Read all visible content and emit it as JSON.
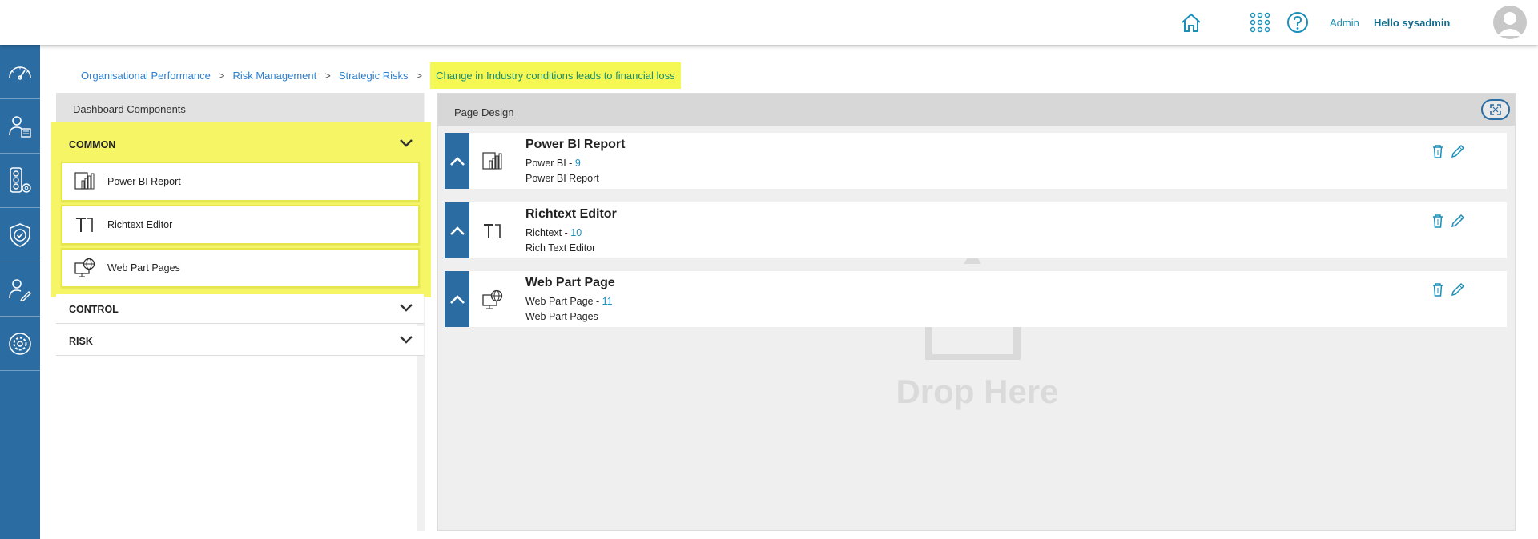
{
  "header": {
    "admin_label": "Admin",
    "greeting": "Hello sysadmin",
    "icons": [
      "home-icon",
      "apps-grid-icon",
      "help-icon",
      "avatar"
    ]
  },
  "sidebar": {
    "items": [
      {
        "icon": "dashboard-gauge-icon"
      },
      {
        "icon": "user-document-icon"
      },
      {
        "icon": "traffic-light-settings-icon"
      },
      {
        "icon": "shield-check-icon"
      },
      {
        "icon": "user-edit-icon"
      },
      {
        "icon": "settings-gear-icon"
      }
    ]
  },
  "breadcrumb": {
    "items": [
      "Organisational Performance",
      "Risk Management",
      "Strategic Risks"
    ],
    "separator": ">",
    "current": "Change in Industry conditions leads to financial loss"
  },
  "left_panel": {
    "title": "Dashboard Components",
    "sections": [
      {
        "label": "COMMON",
        "expanded": true,
        "items": [
          {
            "label": "Power BI Report",
            "icon": "powerbi-icon"
          },
          {
            "label": "Richtext Editor",
            "icon": "richtext-icon"
          },
          {
            "label": "Web Part Pages",
            "icon": "web-part-icon"
          }
        ]
      },
      {
        "label": "CONTROL",
        "expanded": false
      },
      {
        "label": "RISK",
        "expanded": false
      }
    ]
  },
  "right_panel": {
    "title": "Page Design",
    "drop_text": "Drop Here",
    "cards": [
      {
        "title": "Power BI Report",
        "subtitle_prefix": "Power BI - ",
        "subtitle_num": "9",
        "description": "Power BI Report",
        "icon": "powerbi-icon"
      },
      {
        "title": "Richtext Editor",
        "subtitle_prefix": "Richtext - ",
        "subtitle_num": "10",
        "description": "Rich Text Editor",
        "icon": "richtext-icon"
      },
      {
        "title": "Web Part Page",
        "subtitle_prefix": "Web Part Page - ",
        "subtitle_num": "11",
        "description": "Web Part Pages",
        "icon": "web-part-icon"
      }
    ]
  },
  "colors": {
    "primary": "#2b6ca3",
    "accent": "#1a8fb8",
    "highlight": "#f5f566"
  }
}
